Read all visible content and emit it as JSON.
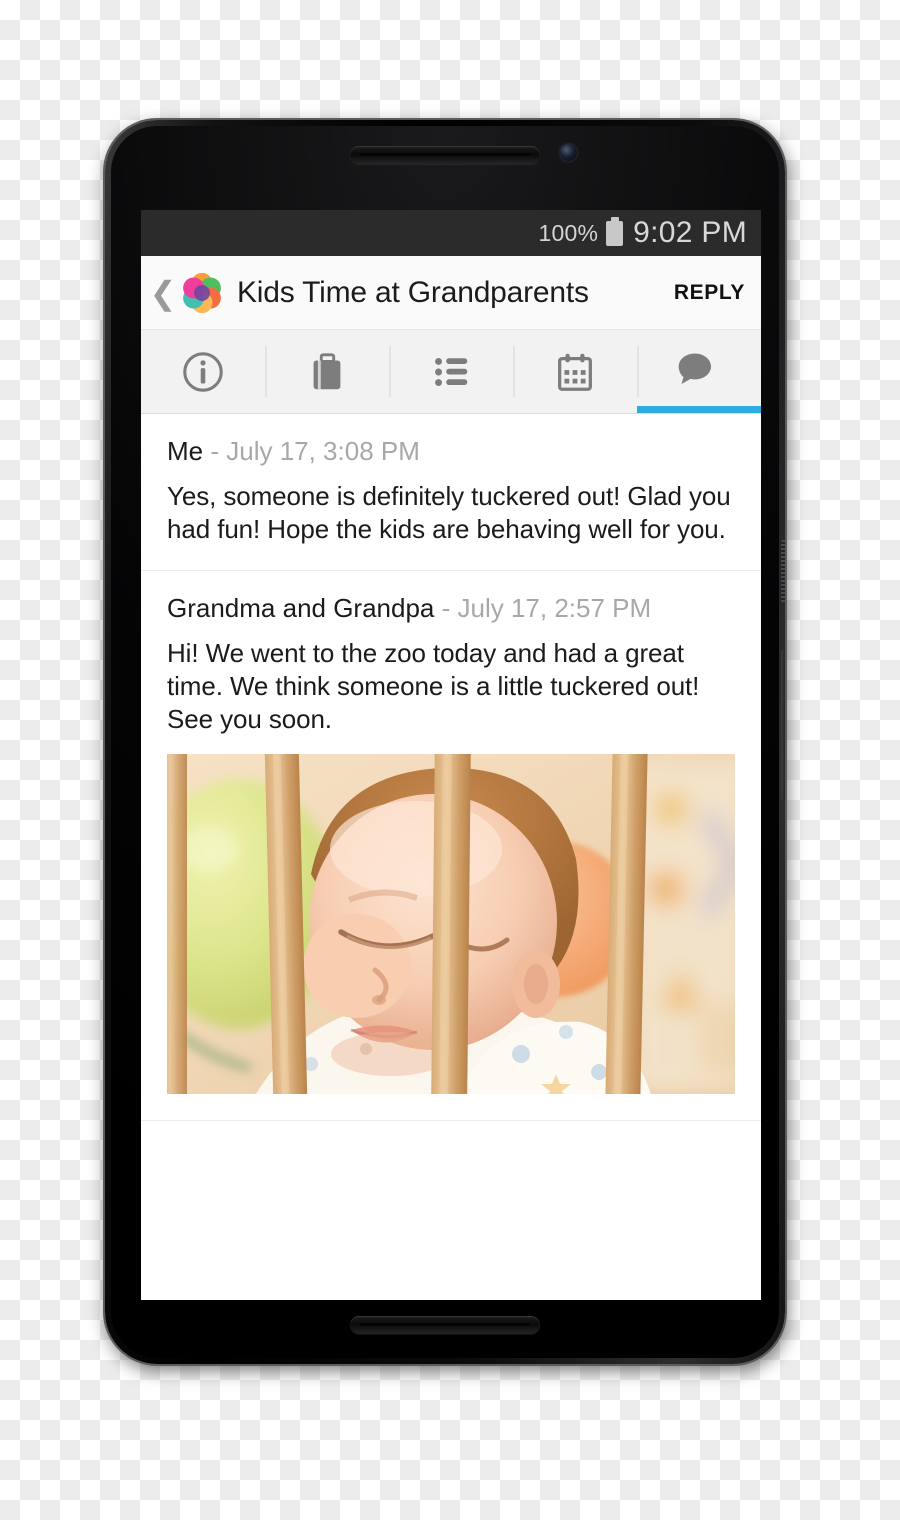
{
  "device": {
    "name": "android-smartphone",
    "speaker_top": "ear-speaker",
    "speaker_bottom": "bottom-speaker",
    "front_camera": "front-camera",
    "power_button": "power-button",
    "volume_button": "volume-rocker"
  },
  "status_bar": {
    "battery_percent": "100%",
    "battery_icon": "battery-full-icon",
    "time": "9:02 PM"
  },
  "app_bar": {
    "back_icon": "chevron-left-icon",
    "logo_icon": "app-logo-flower-icon",
    "title": "Kids Time at Grandparents",
    "reply_label": "REPLY"
  },
  "tabs": [
    {
      "id": "info",
      "icon": "info-circle-icon",
      "active": false
    },
    {
      "id": "packing",
      "icon": "suitcase-icon",
      "active": false
    },
    {
      "id": "list",
      "icon": "bullet-list-icon",
      "active": false
    },
    {
      "id": "calendar",
      "icon": "calendar-icon",
      "active": false
    },
    {
      "id": "messages",
      "icon": "chat-bubbles-icon",
      "active": true
    }
  ],
  "messages": [
    {
      "author": "Me",
      "meta": " - July 17, 3:08 PM",
      "body": "Yes, someone is definitely tuckered out!  Glad you had fun!  Hope the kids are behaving well for you.",
      "has_photo": false
    },
    {
      "author": "Grandma and Grandpa",
      "meta": " - July 17, 2:57 PM",
      "body": "Hi!  We went to the zoo today and had a great time. We think someone is a little tuckered out!  See you soon.",
      "has_photo": true,
      "photo_alt": "sleeping baby in crib behind wooden bars with a yellow-green balloon"
    }
  ],
  "colors": {
    "accent_blue": "#2eabe2",
    "status_bar_bg": "#2b2b2b",
    "app_bar_bg": "#fafafa",
    "tab_bar_bg": "#f2f2f2",
    "text_primary": "#1b1b1b",
    "text_muted": "#a8a8a8"
  }
}
